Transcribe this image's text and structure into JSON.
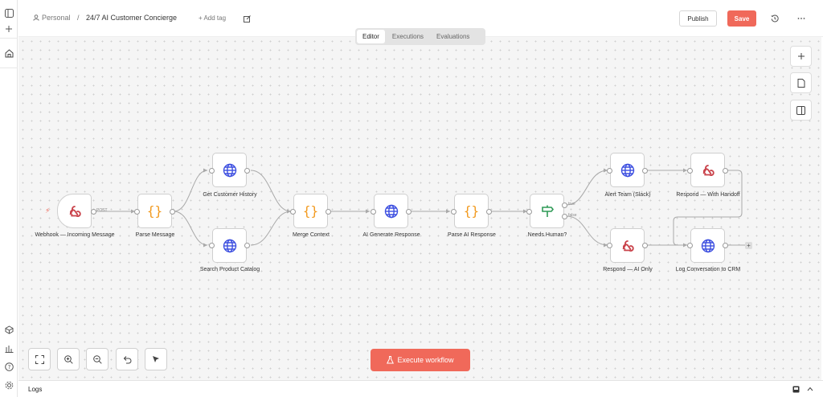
{
  "header": {
    "owner": "Personal",
    "separator": "/",
    "workflow_name": "24/7 AI Customer Concierge",
    "add_tag": "+ Add tag",
    "publish_label": "Publish",
    "save_label": "Save"
  },
  "tabs": [
    {
      "label": "Editor",
      "active": true
    },
    {
      "label": "Executions",
      "active": false
    },
    {
      "label": "Evaluations",
      "active": false
    }
  ],
  "nodes": [
    {
      "id": "webhook",
      "label": "Webhook — Incoming Message",
      "icon": "webhook-icon"
    },
    {
      "id": "parse_message",
      "label": "Parse Message",
      "icon": "code-braces-icon"
    },
    {
      "id": "get_history",
      "label": "Get Customer History",
      "icon": "globe-icon"
    },
    {
      "id": "search_catalog",
      "label": "Search Product Catalog",
      "icon": "globe-icon"
    },
    {
      "id": "merge_context",
      "label": "Merge Context",
      "icon": "code-braces-icon"
    },
    {
      "id": "ai_generate",
      "label": "AI Generate Response",
      "icon": "globe-icon"
    },
    {
      "id": "parse_ai",
      "label": "Parse AI Response",
      "icon": "code-braces-icon"
    },
    {
      "id": "needs_human",
      "label": "Needs Human?",
      "icon": "signpost-icon"
    },
    {
      "id": "alert_team",
      "label": "Alert Team (Slack)",
      "icon": "globe-icon"
    },
    {
      "id": "respond_handoff",
      "label": "Respond — With Handoff",
      "icon": "webhook-icon"
    },
    {
      "id": "respond_ai",
      "label": "Respond — AI Only",
      "icon": "webhook-icon"
    },
    {
      "id": "log_crm",
      "label": "Log Conversation to CRM",
      "icon": "globe-icon"
    }
  ],
  "port_tags": {
    "post": "POST",
    "true": "true",
    "false": "false"
  },
  "execute_label": "Execute workflow",
  "logs_label": "Logs",
  "colors": {
    "accent": "#f0695a",
    "globe": "#3d4fe0",
    "braces": "#f29a1f",
    "webhook": "#c9424a",
    "signpost": "#2f9a57"
  }
}
